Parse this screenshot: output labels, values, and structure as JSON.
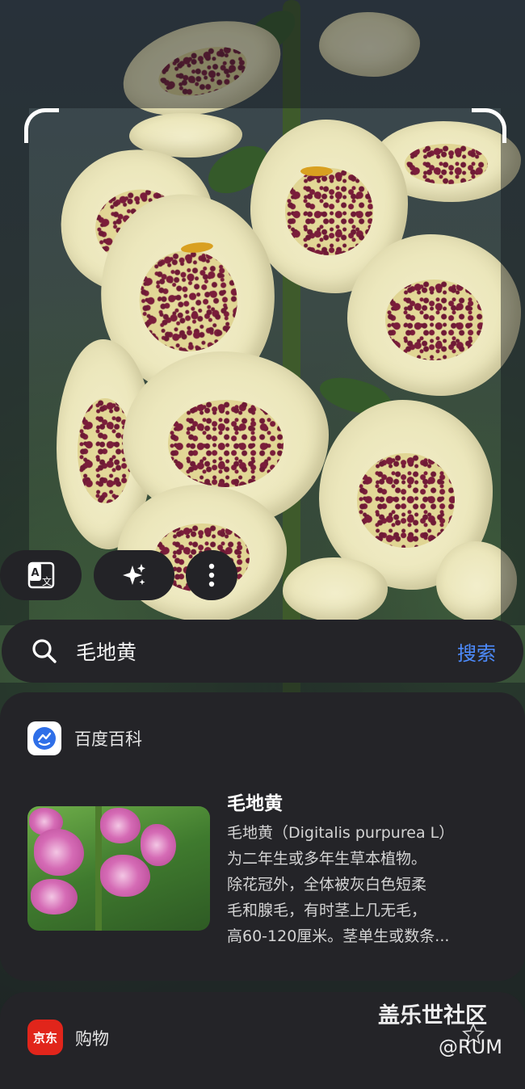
{
  "background": {
    "description_icon": "foxglove-photo",
    "accent": "#4d8cff"
  },
  "actions": {
    "translate_icon": "translate-icon",
    "magic_icon": "sparkle-icon",
    "more_icon": "more-vertical-icon"
  },
  "search": {
    "icon": "search-icon",
    "query": "毛地黄",
    "button_label": "搜索"
  },
  "result_card": {
    "source_label": "百度百科",
    "source_icon": "baidu-baike-icon",
    "title": "毛地黄",
    "description_lines": [
      "毛地黄（Digitalis purpurea L）",
      "为二年生或多年生草本植物。",
      "除花冠外，全体被灰白色短柔",
      "毛和腺毛，有时茎上几无毛，",
      "高60-120厘米。茎单生或数条..."
    ]
  },
  "shopping_card": {
    "logo_text": "京东",
    "label": "购物"
  },
  "watermark": {
    "title": "盖乐世社区",
    "handle": "@RUM"
  }
}
